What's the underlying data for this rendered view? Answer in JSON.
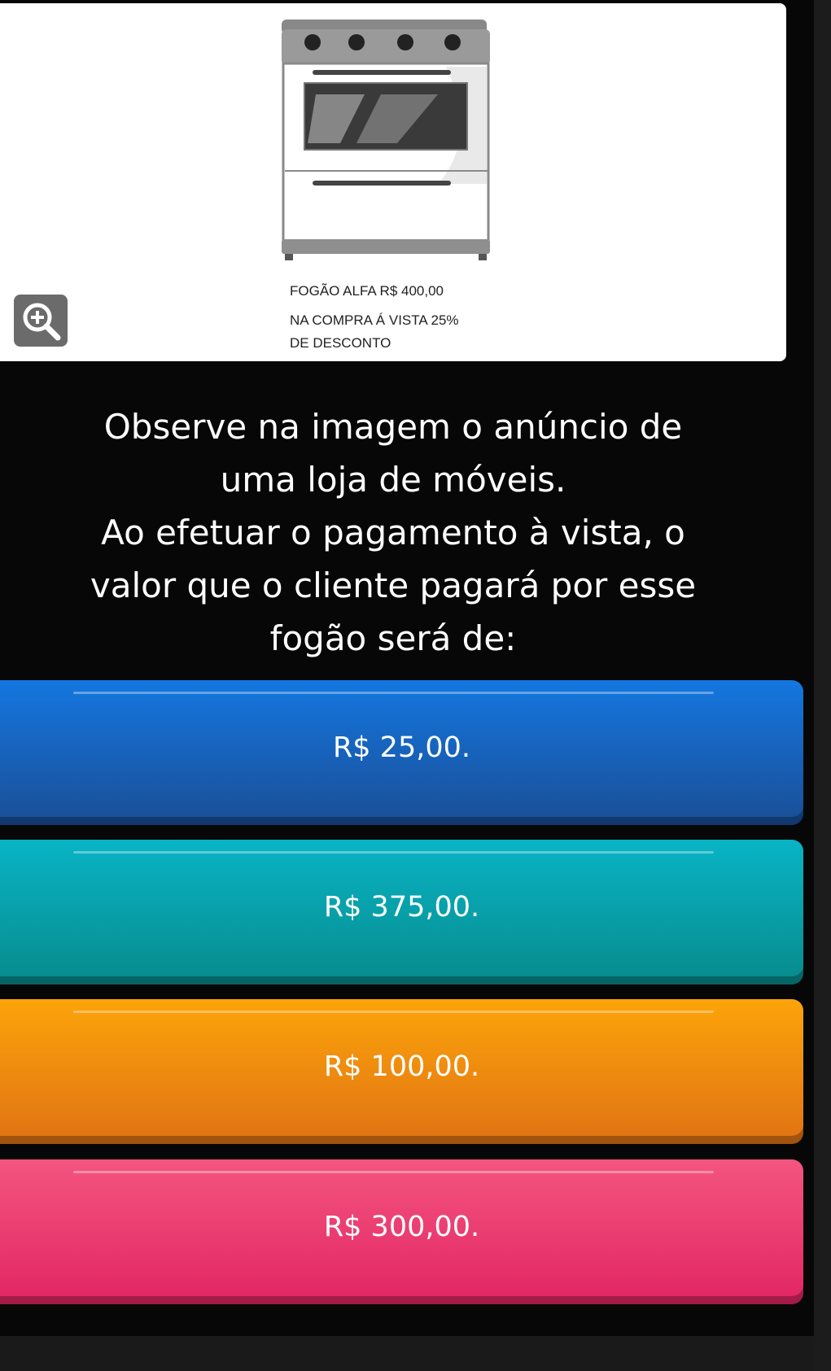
{
  "ad": {
    "line1": "FOGÃO ALFA   R$ 400,00",
    "line2": "NA COMPRA Á VISTA 25%",
    "line3": "DE DESCONTO"
  },
  "zoom_icon": "zoom-in-icon",
  "question": {
    "lines": [
      "Observe na imagem o anúncio de",
      "uma loja de móveis.",
      "Ao efetuar o pagamento à vista, o",
      "valor que o cliente pagará por esse",
      "fogão será de:"
    ]
  },
  "answers": [
    {
      "label": "R$ 25,00.",
      "color": "#1477e0"
    },
    {
      "label": "R$ 375,00.",
      "color": "#08b4c5"
    },
    {
      "label": "R$ 100,00.",
      "color": "#fca40a"
    },
    {
      "label": "R$ 300,00.",
      "color": "#f4557f"
    }
  ]
}
